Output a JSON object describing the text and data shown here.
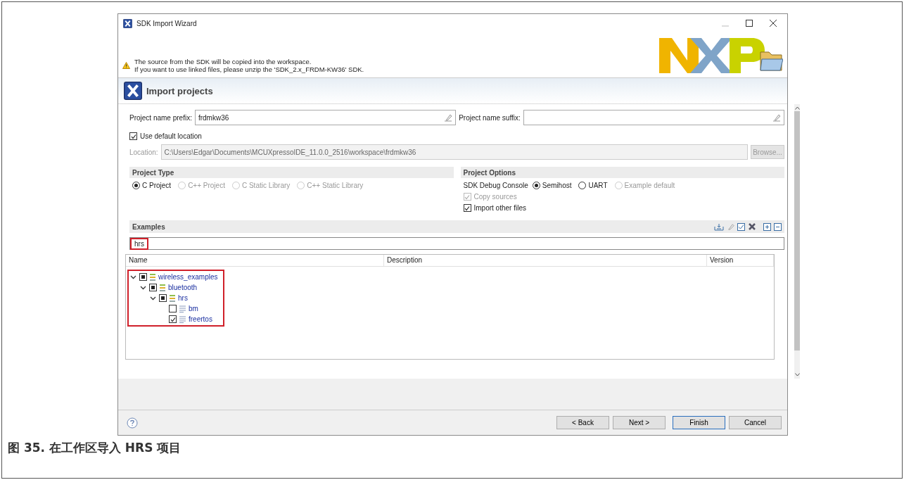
{
  "window": {
    "title": "SDK Import Wizard"
  },
  "banner": {
    "lines": [
      "The source from the SDK will be copied into the workspace.",
      "If you want to use linked files, please unzip the 'SDK_2.x_FRDM-KW36' SDK."
    ]
  },
  "page_title": "Import projects",
  "prefix": {
    "label": "Project name prefix:",
    "value": "frdmkw36"
  },
  "suffix": {
    "label": "Project name suffix:"
  },
  "use_default_location": {
    "label": "Use default location",
    "checked": true
  },
  "location": {
    "label": "Location:",
    "value": "C:\\Users\\Edgar\\Documents\\MCUXpressoIDE_11.0.0_2516\\workspace\\frdmkw36",
    "disabled": true,
    "browse": "Browse..."
  },
  "project_type": {
    "title": "Project Type",
    "options": [
      {
        "label": "C Project",
        "selected": true,
        "disabled": false
      },
      {
        "label": "C++ Project",
        "selected": false,
        "disabled": true
      },
      {
        "label": "C Static Library",
        "selected": false,
        "disabled": true
      },
      {
        "label": "C++ Static Library",
        "selected": false,
        "disabled": true
      }
    ]
  },
  "project_options": {
    "title": "Project Options",
    "console_label": "SDK Debug Console",
    "console_options": [
      {
        "label": "Semihost",
        "selected": true,
        "disabled": false
      },
      {
        "label": "UART",
        "selected": false,
        "disabled": false
      },
      {
        "label": "Example default",
        "selected": false,
        "disabled": true
      }
    ],
    "checks": [
      {
        "label": "Copy sources",
        "checked": true,
        "disabled": true
      },
      {
        "label": "Import other files",
        "checked": true,
        "disabled": false
      }
    ]
  },
  "examples": {
    "title": "Examples",
    "filter": "hrs",
    "columns": [
      "Name",
      "Description",
      "Version"
    ],
    "tree": [
      {
        "label": "wireless_examples",
        "kind": "folder",
        "checked": true,
        "partial": true,
        "expanded": true,
        "children": [
          {
            "label": "bluetooth",
            "kind": "folder",
            "checked": true,
            "partial": true,
            "expanded": true,
            "children": [
              {
                "label": "hrs",
                "kind": "folder",
                "checked": true,
                "partial": true,
                "expanded": true,
                "children": [
                  {
                    "label": "bm",
                    "kind": "project",
                    "checked": false
                  },
                  {
                    "label": "freertos",
                    "kind": "project",
                    "checked": true
                  }
                ]
              }
            ]
          }
        ]
      }
    ]
  },
  "buttons": [
    {
      "label": "< Back",
      "default": false
    },
    {
      "label": "Next >",
      "default": false
    },
    {
      "label": "Finish",
      "default": true
    },
    {
      "label": "Cancel",
      "default": false
    }
  ],
  "caption": "图 35. 在工作区导入 HRS 项目"
}
